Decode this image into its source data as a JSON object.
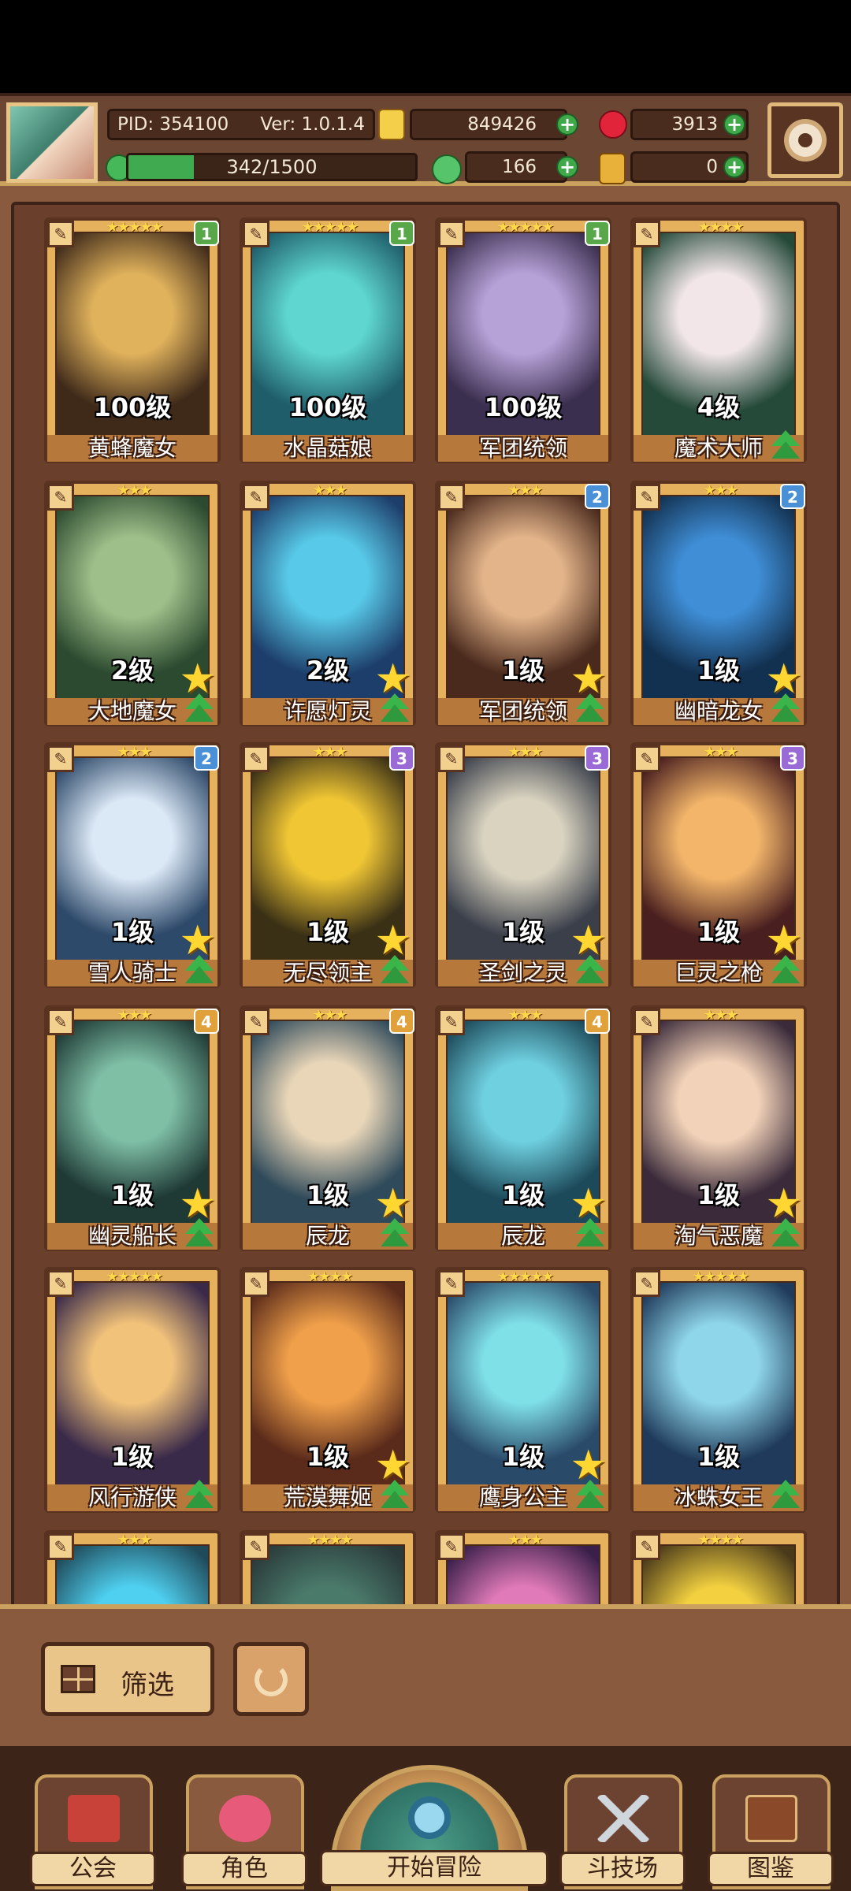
{
  "header": {
    "pid": "PID: 354100",
    "version": "Ver: 1.0.1.4",
    "gold": "849426",
    "gems": "3913",
    "exp": "342/1500",
    "exp_progress": 0.228,
    "clover": "166",
    "boots": "0"
  },
  "characters": [
    {
      "name": "黄蜂魔女",
      "level": "100级",
      "rank": "1",
      "stars": "★★★★★",
      "palette": [
        "#3f2a1a",
        "#e0b25c"
      ],
      "bigstar": false,
      "upgrade": false
    },
    {
      "name": "水晶菇娘",
      "level": "100级",
      "rank": "1",
      "stars": "★★★★★",
      "palette": [
        "#1f5d6a",
        "#5fd7d0"
      ],
      "bigstar": false,
      "upgrade": false
    },
    {
      "name": "军团统领",
      "level": "100级",
      "rank": "1",
      "stars": "★★★★★",
      "palette": [
        "#3b2f4f",
        "#b7a2d8"
      ],
      "bigstar": false,
      "upgrade": false
    },
    {
      "name": "魔术大师",
      "level": "4级",
      "rank": "",
      "stars": "★★★★",
      "palette": [
        "#254a3a",
        "#f2e6e8"
      ],
      "bigstar": false,
      "upgrade": true
    },
    {
      "name": "大地魔女",
      "level": "2级",
      "rank": "",
      "stars": "★★★",
      "palette": [
        "#2b4a2f",
        "#9fbf8a"
      ],
      "bigstar": true,
      "upgrade": true
    },
    {
      "name": "许愿灯灵",
      "level": "2级",
      "rank": "",
      "stars": "★★★",
      "palette": [
        "#1d3e6a",
        "#58c9e8"
      ],
      "bigstar": true,
      "upgrade": true
    },
    {
      "name": "军团统领",
      "level": "1级",
      "rank": "2",
      "stars": "★★★",
      "palette": [
        "#4a2a1d",
        "#e3b48a"
      ],
      "bigstar": true,
      "upgrade": true
    },
    {
      "name": "幽暗龙女",
      "level": "1级",
      "rank": "2",
      "stars": "★★★",
      "palette": [
        "#12304f",
        "#3f8ed6"
      ],
      "bigstar": true,
      "upgrade": true
    },
    {
      "name": "雪人骑士",
      "level": "1级",
      "rank": "2",
      "stars": "★★★",
      "palette": [
        "#2e4a6a",
        "#dbe8f6"
      ],
      "bigstar": true,
      "upgrade": true
    },
    {
      "name": "无尽领主",
      "level": "1级",
      "rank": "3",
      "stars": "★★★",
      "palette": [
        "#3a3016",
        "#f0c634"
      ],
      "bigstar": true,
      "upgrade": true
    },
    {
      "name": "圣剑之灵",
      "level": "1级",
      "rank": "3",
      "stars": "★★★",
      "palette": [
        "#3a3f4a",
        "#d9d3c0"
      ],
      "bigstar": true,
      "upgrade": true
    },
    {
      "name": "巨灵之枪",
      "level": "1级",
      "rank": "3",
      "stars": "★★★",
      "palette": [
        "#4a1f1f",
        "#f2b56a"
      ],
      "bigstar": true,
      "upgrade": true
    },
    {
      "name": "幽灵船长",
      "level": "1级",
      "rank": "4",
      "stars": "★★★",
      "palette": [
        "#1f3a35",
        "#7fbfa6"
      ],
      "bigstar": true,
      "upgrade": true
    },
    {
      "name": "辰龙",
      "level": "1级",
      "rank": "4",
      "stars": "★★★",
      "palette": [
        "#2f4a5a",
        "#e9d6b8"
      ],
      "bigstar": true,
      "upgrade": true
    },
    {
      "name": "辰龙",
      "level": "1级",
      "rank": "4",
      "stars": "★★★",
      "palette": [
        "#1d4a5a",
        "#6fd0e0"
      ],
      "bigstar": true,
      "upgrade": true
    },
    {
      "name": "淘气恶魔",
      "level": "1级",
      "rank": "",
      "stars": "★★★",
      "palette": [
        "#3a2a3a",
        "#f2d2b8"
      ],
      "bigstar": true,
      "upgrade": true
    },
    {
      "name": "风行游侠",
      "level": "1级",
      "rank": "",
      "stars": "★★★★★",
      "palette": [
        "#3a2a4a",
        "#f1c27a"
      ],
      "bigstar": false,
      "upgrade": true
    },
    {
      "name": "荒漠舞姬",
      "level": "1级",
      "rank": "",
      "stars": "★★★★",
      "palette": [
        "#5a2a1a",
        "#f0a04a"
      ],
      "bigstar": true,
      "upgrade": true
    },
    {
      "name": "鹰身公主",
      "level": "1级",
      "rank": "",
      "stars": "★★★★★",
      "palette": [
        "#2a4a6a",
        "#7fe0e8"
      ],
      "bigstar": true,
      "upgrade": true
    },
    {
      "name": "冰蛛女王",
      "level": "1级",
      "rank": "",
      "stars": "★★★★★",
      "palette": [
        "#1f3a5a",
        "#8fd6ea"
      ],
      "bigstar": false,
      "upgrade": true
    },
    {
      "name": "",
      "level": "",
      "rank": "",
      "stars": "★★★",
      "palette": [
        "#1f4a5a",
        "#4fd0f0"
      ],
      "bigstar": false,
      "upgrade": false
    },
    {
      "name": "",
      "level": "",
      "rank": "",
      "stars": "★★★★",
      "palette": [
        "#2a3a3a",
        "#4a7a6a"
      ],
      "bigstar": false,
      "upgrade": false
    },
    {
      "name": "",
      "level": "",
      "rank": "",
      "stars": "★★★",
      "palette": [
        "#3a1f4a",
        "#e07ab8"
      ],
      "bigstar": false,
      "upgrade": false
    },
    {
      "name": "",
      "level": "",
      "rank": "",
      "stars": "★★★★",
      "palette": [
        "#4a3a1a",
        "#f2d040"
      ],
      "bigstar": false,
      "upgrade": false
    }
  ],
  "filter": {
    "label": "筛选"
  },
  "nav": {
    "guild": "公会",
    "roles": "角色",
    "adventure": "开始冒险",
    "arena": "斗技场",
    "codex": "图鉴"
  },
  "colors": {
    "rank1": "#58a84a",
    "rank2": "#4a90d6",
    "rank3": "#9a6ad6",
    "rank4": "#e0a03a"
  }
}
